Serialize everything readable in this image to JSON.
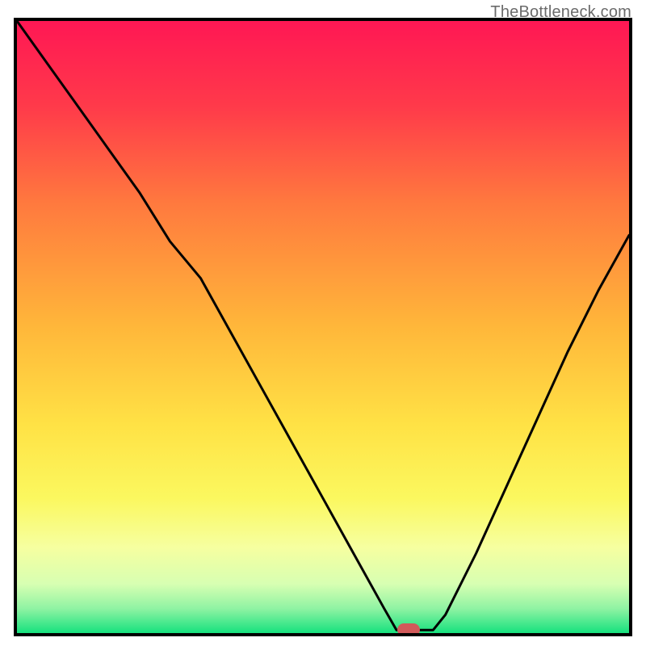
{
  "watermark": "TheBottleneck.com",
  "chart_data": {
    "type": "line",
    "title": "",
    "xlabel": "",
    "ylabel": "",
    "xlim": [
      0,
      100
    ],
    "ylim": [
      0,
      100
    ],
    "series": [
      {
        "name": "bottleneck-curve",
        "x": [
          0,
          5,
          10,
          15,
          20,
          25,
          30,
          35,
          40,
          45,
          50,
          55,
          60,
          62,
          65,
          68,
          70,
          75,
          80,
          85,
          90,
          95,
          100
        ],
        "values": [
          100,
          93,
          86,
          79,
          72,
          64,
          58,
          49,
          40,
          31,
          22,
          13,
          4,
          0.5,
          0.5,
          0.5,
          3,
          13,
          24,
          35,
          46,
          56,
          65
        ]
      }
    ],
    "marker": {
      "x": 64,
      "y": 0.5
    },
    "gradient_stops": [
      {
        "pct": 0,
        "color": "#ff1754"
      },
      {
        "pct": 14,
        "color": "#ff3a4a"
      },
      {
        "pct": 30,
        "color": "#ff7a3e"
      },
      {
        "pct": 50,
        "color": "#ffb73a"
      },
      {
        "pct": 66,
        "color": "#ffe245"
      },
      {
        "pct": 78,
        "color": "#fbf85f"
      },
      {
        "pct": 86,
        "color": "#f6ffa0"
      },
      {
        "pct": 92,
        "color": "#d7ffb2"
      },
      {
        "pct": 96,
        "color": "#8ff3a3"
      },
      {
        "pct": 100,
        "color": "#16e17e"
      }
    ]
  }
}
